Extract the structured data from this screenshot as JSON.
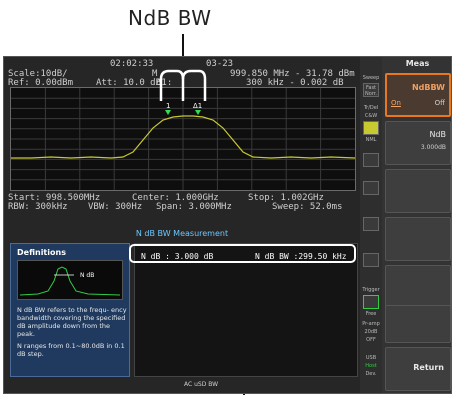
{
  "callout": {
    "title": "NdB BW"
  },
  "header": {
    "time_left": "02:02:33",
    "time_right": "03-23",
    "scale": "Scale:10dB/",
    "ref": "Ref: 0.00dBm",
    "att": "Att: 10.0 dB",
    "marker_label": "M",
    "marker_delta": "Δ1:",
    "marker_freq": "999.850 MHz - 31.78 dBm",
    "delta_freq": "300 kHz  - 0.002  dB"
  },
  "markers": {
    "m1": "1",
    "m2": "Δ1"
  },
  "footer": {
    "start": "Start: 998.500MHz",
    "center": "Center: 1.000GHz",
    "stop": "Stop: 1.002GHz",
    "rbw": "RBW: 300kHz",
    "vbw": "VBW: 300Hz",
    "span": "Span: 3.000MHz",
    "sweep": "Sweep: 52.0ms"
  },
  "measurement": {
    "title": "N dB BW Measurement",
    "ndb_label": "N dB",
    "ndb_value": ":  3.000  dB",
    "ndbbw_label": "N dB BW",
    "ndbbw_value": ":299.50  kHz"
  },
  "definitions": {
    "title": "Definitions",
    "mini_label": "N dB",
    "text1": "N dB BW refers to the frequ- ency bandwidth covering the specified dB amplitude down from the peak.",
    "text2": "N ranges from 0.1~80.0dB in 0.1 dB step."
  },
  "status": {
    "ac": "AC",
    "usd": "uSD",
    "bw": "BW"
  },
  "side": {
    "sweep": "Sweep",
    "fast": "Fast",
    "norr": "Norr.",
    "tr": "Tr/Del",
    "cw": "C&W",
    "nml": "NML",
    "trigger": "Trigger",
    "free": "Free",
    "preamp": "Pr-amp",
    "db": "20dB",
    "off": "OFF",
    "usb": "USB",
    "host": "Host",
    "dev": "Dev."
  },
  "softkeys": {
    "menu_title": "Meas",
    "ndbbw_label": "NdBBW",
    "on": "On",
    "off": "Off",
    "ndb_label": "NdB",
    "ndb_value": "3.000dB",
    "return": "Return"
  },
  "colors": {
    "trace": "#c8c830",
    "active": "#e8771f",
    "panel_blue": "#1f3a5e"
  },
  "icons": {
    "logo": "GW-logo"
  }
}
